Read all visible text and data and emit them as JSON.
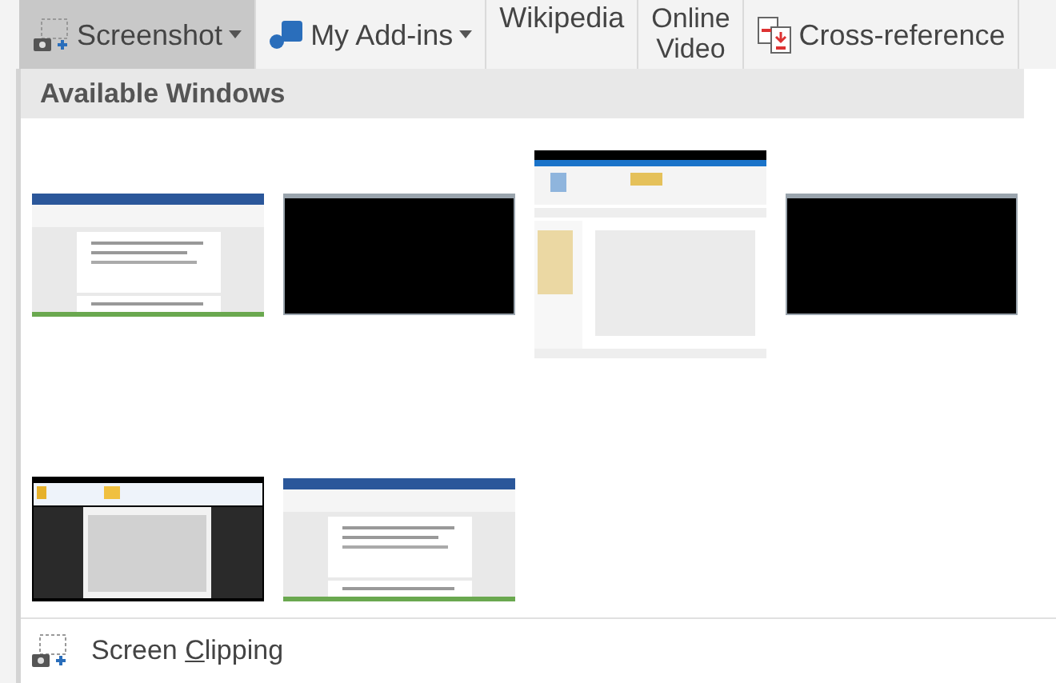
{
  "ribbon": {
    "items": [
      {
        "kind": "screenshot",
        "label": "Screenshot",
        "dropdown": true,
        "selected": true
      },
      {
        "kind": "addins",
        "label": "My Add-ins",
        "dropdown": true,
        "selected": false
      },
      {
        "kind": "cut",
        "label": "Wikipedia",
        "selected": false
      },
      {
        "kind": "two-line",
        "label": "Online",
        "label_2": "Video",
        "selected": false
      },
      {
        "kind": "crossref",
        "label": "Cross-reference",
        "selected": false
      }
    ]
  },
  "menu": {
    "header": "Available Windows",
    "windows": [
      {
        "kind": "document"
      },
      {
        "kind": "black"
      },
      {
        "kind": "explorer"
      },
      {
        "kind": "black"
      },
      {
        "kind": "reader"
      },
      {
        "kind": "document"
      }
    ],
    "commands": [
      {
        "label_before": "Screen ",
        "access_key": "C",
        "label_after": "lipping"
      }
    ]
  }
}
